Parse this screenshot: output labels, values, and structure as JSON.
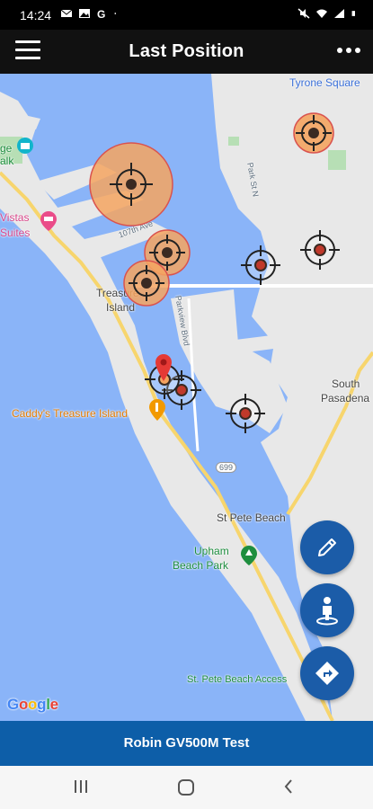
{
  "status_bar": {
    "time": "14:24",
    "left_icons": [
      "message-icon",
      "photo-icon",
      "google-icon",
      "dot-icon"
    ],
    "right_icons": [
      "mute-icon",
      "wifi-icon",
      "signal-icon",
      "battery-icon"
    ]
  },
  "app_bar": {
    "title": "Last Position",
    "menu_icon": "hamburger-menu-icon",
    "more_icon": "more-dots-icon"
  },
  "map": {
    "labels": {
      "tyrone_square": "Tyrone Square",
      "treasure_island_1": "Treasure",
      "treasure_island_2": "Island",
      "vistas_1": "Vistas",
      "vistas_2": "Suites",
      "park_1": "ge",
      "park_2": "alk",
      "caddys": "Caddy's Treasure Island",
      "south_pasadena_1": "South",
      "south_pasadena_2": "Pasadena",
      "st_pete_beach": "St Pete Beach",
      "upham_1": "Upham",
      "upham_2": "Beach Park",
      "st_pete_access": "St. Pete Beach Access",
      "street_parkview": "Parkview Blvd",
      "street_park": "Park St N",
      "street_107": "107th Ave",
      "road_699": "699"
    },
    "google_logo": {
      "letters": [
        "G",
        "o",
        "o",
        "g",
        "l",
        "e"
      ],
      "colors": [
        "#4285f4",
        "#ea4335",
        "#fbbc05",
        "#4285f4",
        "#34a853",
        "#ea4335"
      ]
    }
  },
  "fabs": {
    "edit": "pencil-icon",
    "person": "person-pin-icon",
    "directions": "directions-icon",
    "color": "#1b5ca8"
  },
  "bottom_bar": {
    "title": "Robin GV500M Test"
  },
  "colors": {
    "water": "#8ab4f8",
    "land": "#e8e8e8",
    "marker_fill": "#f4a460",
    "marker_ring": "#d9534f",
    "pin": "#e53935"
  }
}
